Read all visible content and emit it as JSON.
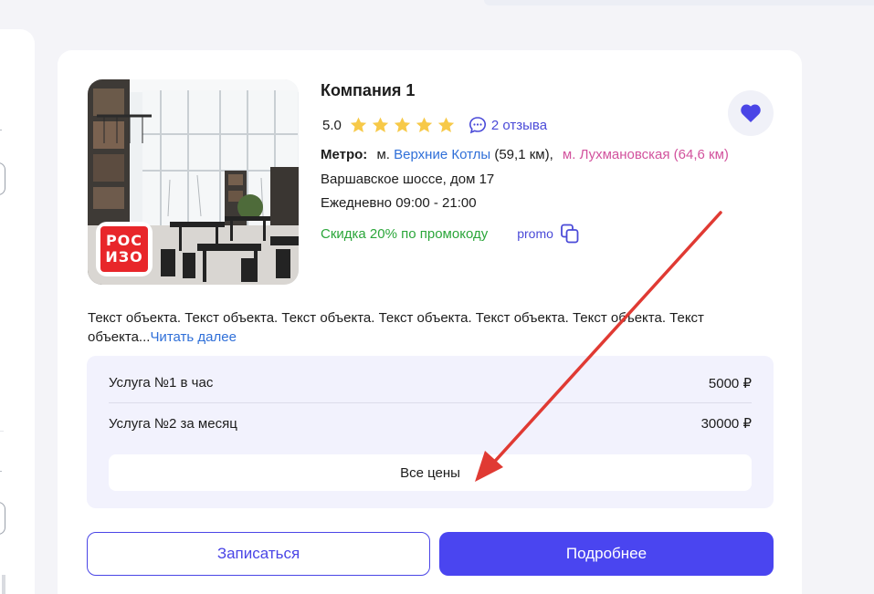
{
  "card": {
    "company_name": "Компания 1",
    "logo_text_top": "РОС",
    "logo_text_bottom": "ИЗО",
    "rating": "5.0",
    "stars_count": 5,
    "reviews_label": "2 отзыва",
    "metro_label": "Метро:",
    "metro_prefix_1": "м.",
    "metro_station_1": "Верхние Котлы",
    "metro_distance_1": "(59,1 км),",
    "metro_station_2": "м. Лухмановская (64,6 км)",
    "address": "Варшавское шоссе, дом 17",
    "hours": "Ежедневно 09:00 - 21:00",
    "discount": "Скидка 20% по промокоду",
    "promo_code": "promo",
    "description": "Текст объекта. Текст объекта. Текст объекта. Текст объекта. Текст объекта. Текст объекта. Текст объекта...",
    "read_more": "Читать далее"
  },
  "prices": {
    "rows": [
      {
        "name": "Услуга №1 в час",
        "price": "5000 ₽"
      },
      {
        "name": "Услуга №2 за месяц",
        "price": "30000 ₽"
      }
    ],
    "all_prices_label": "Все цены"
  },
  "actions": {
    "book_label": "Записаться",
    "details_label": "Подробнее"
  },
  "colors": {
    "accent": "#4a45f0",
    "favorite_heart": "#4a45e6",
    "star": "#f7c948",
    "metro_blue": "#2f6fd8",
    "metro_pink": "#d2529d",
    "discount_green": "#2ba63a",
    "annotation_arrow": "#e03a33"
  },
  "icons": {
    "favorite": "heart-icon",
    "reviews": "chat-bubble-icon",
    "copy": "copy-icon",
    "rating": "star-icon"
  }
}
